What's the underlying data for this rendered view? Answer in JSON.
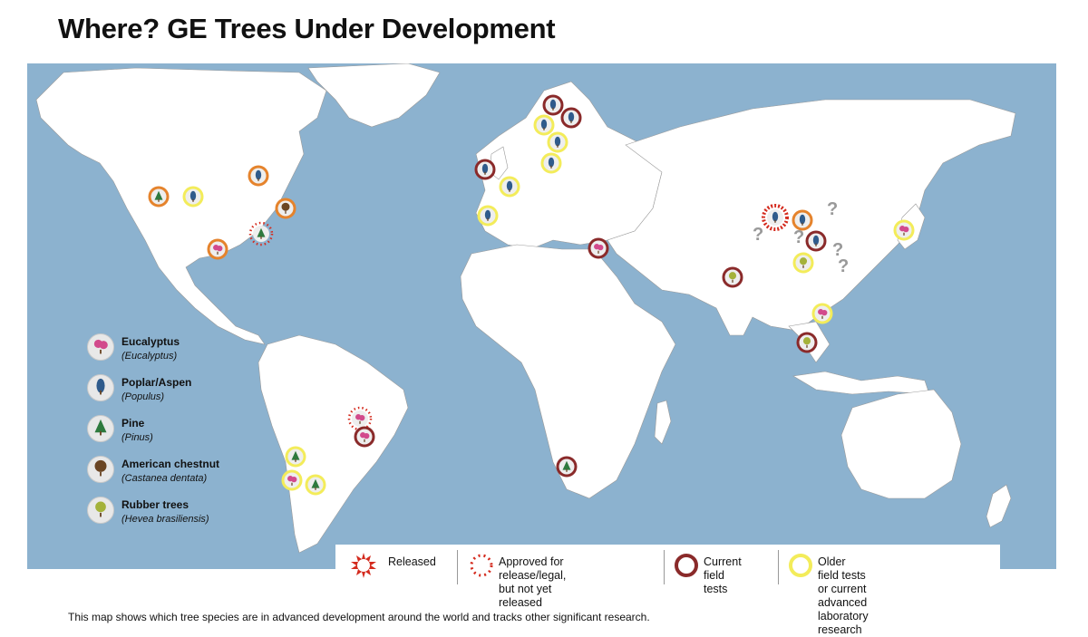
{
  "title": "Where? GE Trees Under Development",
  "caption": "This map shows which tree species are in advanced development around the world and tracks other significant research.",
  "colors": {
    "ocean": "#8cb2cf",
    "land": "#ffffff",
    "released": "#d42b1e",
    "approved": "#d42b1e",
    "current": "#8a2a2a",
    "older": "#f3ec5a",
    "orange_ring": "#e5832c",
    "eucalyptus": "#d24a8c",
    "poplar": "#2f5b8c",
    "pine": "#2e7a3e",
    "chestnut": "#6a4523",
    "rubber": "#a4b23a"
  },
  "species_legend": [
    {
      "name": "Eucalyptus",
      "scientific": "(Eucalyptus)",
      "icon": "eucalyptus-icon"
    },
    {
      "name": "Poplar/Aspen",
      "scientific": "(Populus)",
      "icon": "poplar-icon"
    },
    {
      "name": "Pine",
      "scientific": "(Pinus)",
      "icon": "pine-icon"
    },
    {
      "name": "American chestnut",
      "scientific": "(Castanea dentata)",
      "icon": "chestnut-icon"
    },
    {
      "name": "Rubber trees",
      "scientific": "(Hevea brasiliensis)",
      "icon": "rubber-tree-icon"
    }
  ],
  "status_legend": {
    "released": "Released",
    "approved_line1": "Approved for release/legal,",
    "approved_line2": "but not yet released",
    "current_line1": "Current",
    "current_line2": "field tests",
    "older_line1": "Older field tests or current",
    "older_line2": "advanced laboratory research"
  },
  "unknown_marker": "?",
  "markers": [
    {
      "region": "Scandinavia",
      "species": "poplar",
      "status": "current"
    },
    {
      "region": "Scandinavia",
      "species": "poplar",
      "status": "current"
    },
    {
      "region": "Scandinavia",
      "species": "poplar",
      "status": "older"
    },
    {
      "region": "Scandinavia",
      "species": "poplar",
      "status": "older"
    },
    {
      "region": "Western Europe",
      "species": "poplar",
      "status": "current"
    },
    {
      "region": "Western Europe",
      "species": "poplar",
      "status": "older"
    },
    {
      "region": "Central Europe",
      "species": "poplar",
      "status": "older"
    },
    {
      "region": "Iberia",
      "species": "poplar",
      "status": "older"
    },
    {
      "region": "Middle East",
      "species": "eucalyptus",
      "status": "current"
    },
    {
      "region": "North America",
      "species": "poplar",
      "status": "orange"
    },
    {
      "region": "North America",
      "species": "pine",
      "status": "orange"
    },
    {
      "region": "North America",
      "species": "chestnut",
      "status": "orange"
    },
    {
      "region": "North America",
      "species": "eucalyptus",
      "status": "orange"
    },
    {
      "region": "North America",
      "species": "pine",
      "status": "approved"
    },
    {
      "region": "North America",
      "species": "poplar",
      "status": "older"
    },
    {
      "region": "China",
      "species": "poplar",
      "status": "released"
    },
    {
      "region": "China",
      "species": "poplar",
      "status": "orange"
    },
    {
      "region": "China",
      "species": "poplar",
      "status": "current"
    },
    {
      "region": "China",
      "species": "rubber",
      "status": "older"
    },
    {
      "region": "India",
      "species": "rubber",
      "status": "current"
    },
    {
      "region": "Southeast Asia",
      "species": "rubber",
      "status": "current"
    },
    {
      "region": "Southeast Asia",
      "species": "eucalyptus",
      "status": "older"
    },
    {
      "region": "Japan",
      "species": "eucalyptus",
      "status": "older"
    },
    {
      "region": "Brazil",
      "species": "eucalyptus",
      "status": "approved"
    },
    {
      "region": "Brazil",
      "species": "eucalyptus",
      "status": "current"
    },
    {
      "region": "Chile",
      "species": "pine",
      "status": "older"
    },
    {
      "region": "Argentina",
      "species": "eucalyptus",
      "status": "older"
    },
    {
      "region": "South Africa",
      "species": "pine",
      "status": "older"
    },
    {
      "region": "New Zealand",
      "species": "pine",
      "status": "current"
    }
  ]
}
